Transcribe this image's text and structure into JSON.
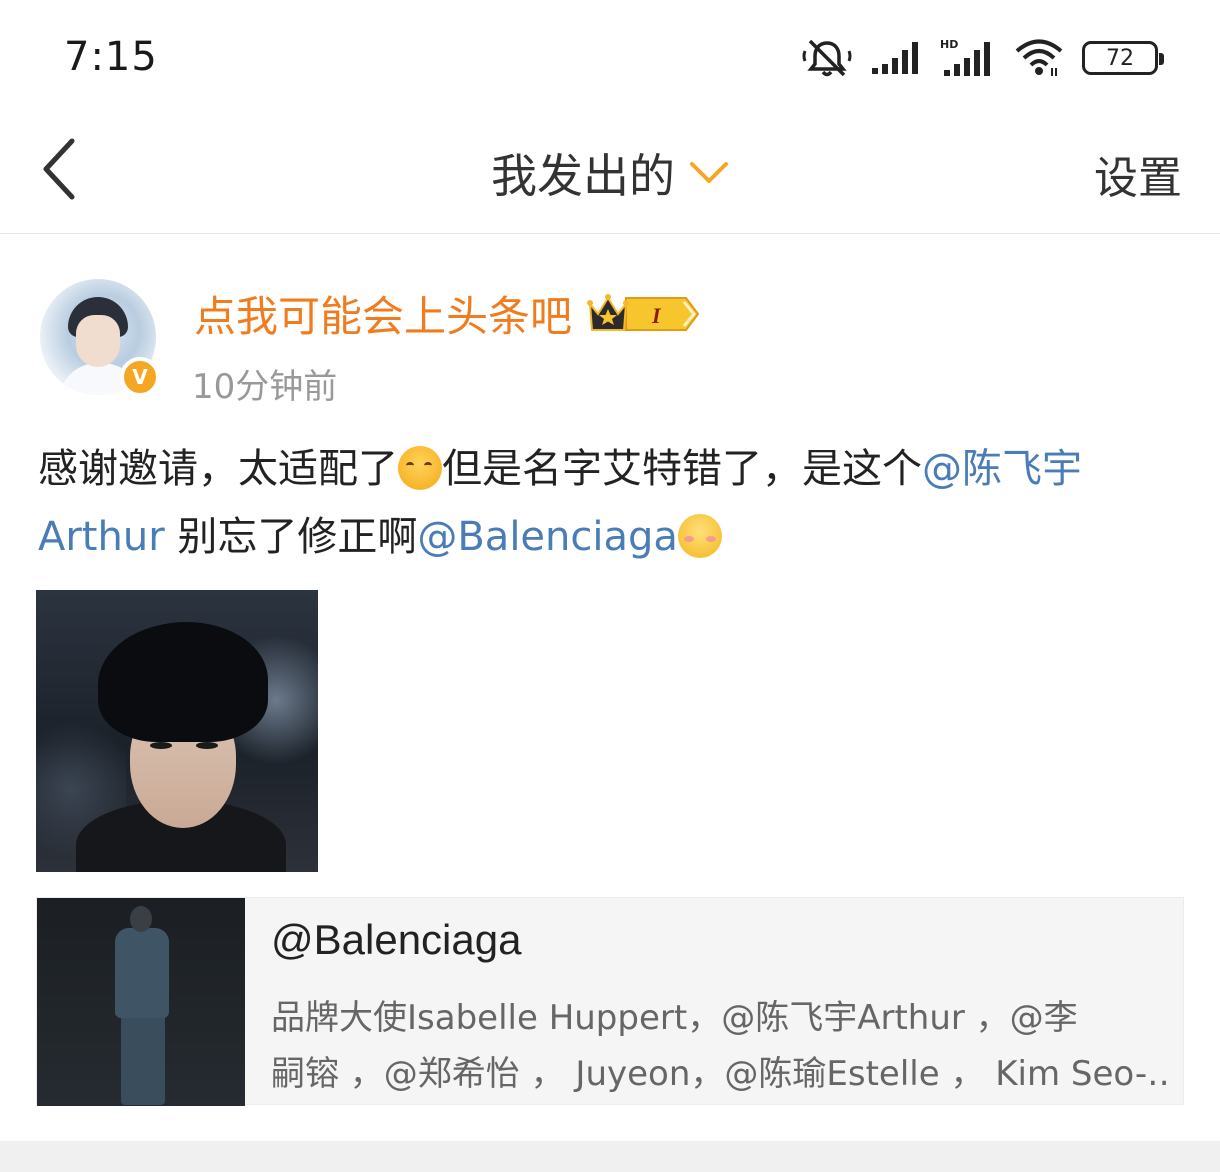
{
  "status_bar": {
    "time": "7:15",
    "battery": "72",
    "icons": [
      "mute-bell-icon",
      "signal-icon",
      "hd-signal-icon",
      "wifi-icon",
      "battery-icon"
    ]
  },
  "nav": {
    "back_icon": "chevron-left-icon",
    "title": "我发出的",
    "dropdown_icon": "chevron-down-icon",
    "settings_label": "设置",
    "accent_color": "#f5a623"
  },
  "post": {
    "username": "点我可能会上头条吧",
    "username_color": "#f07c1e",
    "vip_badge_text": "I",
    "verified_badge_text": "V",
    "timestamp": "10分钟前",
    "text_parts": {
      "p1": "感谢邀请，太适配了",
      "p2": "但是名字艾特错了，是这个",
      "mention1": "@陈飞宇Arthur",
      "p3": " 别忘了修正啊",
      "mention2": "@Balenciaga"
    },
    "emojis": [
      "hug-emoji",
      "shy-emoji"
    ],
    "mention_color": "#4a7db8"
  },
  "link_card": {
    "title": "@Balenciaga",
    "desc_line1": "品牌大使Isabelle Huppert，@陈飞宇Arthur ，@李",
    "desc_line2": "嗣镕 ，@郑希怡 ， Juyeon，@陈瑜Estelle ， Kim Seo-…"
  }
}
